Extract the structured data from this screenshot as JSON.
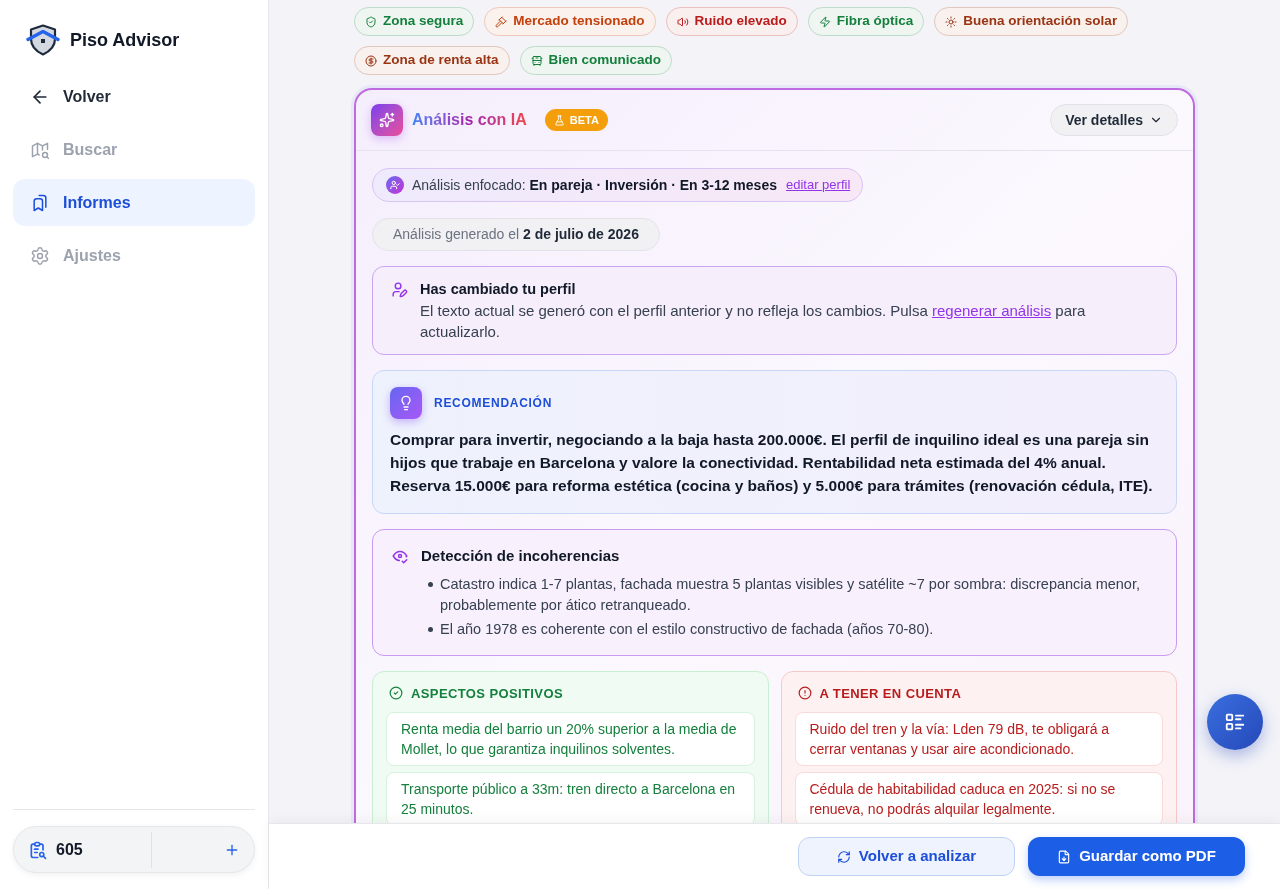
{
  "app": {
    "name": "Piso Advisor"
  },
  "sidebar": {
    "items": [
      {
        "label": "Volver",
        "kind": "back",
        "selected": false
      },
      {
        "label": "Buscar",
        "kind": "nav",
        "selected": false
      },
      {
        "label": "Informes",
        "kind": "nav",
        "selected": true
      },
      {
        "label": "Ajustes",
        "kind": "nav",
        "selected": false
      }
    ]
  },
  "credits": {
    "count": "605"
  },
  "tags": [
    {
      "label": "Zona segura",
      "color": "#15803d"
    },
    {
      "label": "Mercado tensionado",
      "color": "#c2410c"
    },
    {
      "label": "Ruido elevado",
      "color": "#b91c1c"
    },
    {
      "label": "Fibra óptica",
      "color": "#15803d"
    },
    {
      "label": "Buena orientación solar",
      "color": "#9a3412"
    },
    {
      "label": "Zona de renta alta",
      "color": "#9a3412"
    },
    {
      "label": "Bien comunicado",
      "color": "#15803d"
    }
  ],
  "analysis": {
    "title": "Análisis con IA",
    "badge": "BETA",
    "details_button": {
      "label": "Ver detalles",
      "expanded": false
    },
    "focus": {
      "text": "Análisis enfocado: **En pareja · Inversión · En 3-12 meses**",
      "link": "editar perfil"
    },
    "generated": "Análisis generado el **2 de julio de 2026**",
    "profile_notice": {
      "title": "Has cambiado tu perfil",
      "text": "El texto actual se generó con el perfil anterior y no refleja los cambios. Pulsa",
      "link": "regenerar análisis",
      "text_end": "para actualizarlo."
    },
    "recommendation": {
      "label": "RECOMENDACIÓN",
      "text": "Comprar para invertir, negociando a la baja hasta 200.000€. El perfil de inquilino ideal es una pareja sin hijos que trabaje en Barcelona y valore la conectividad. Rentabilidad neta estimada del 4% anual. Reserva 15.000€ para reforma estética (cocina y baños) y 5.000€ para trámites (renovación cédula, ITE)."
    },
    "inconsistencies": {
      "title": "Detección de incoherencias",
      "items": [
        "Catastro indica 1-7 plantas, fachada muestra 5 plantas visibles y satélite ~7 por sombra: discrepancia menor, probablemente por ático retranqueado.",
        "El año 1978 es coherente con el estilo constructivo de fachada (años 70-80)."
      ]
    },
    "positives": {
      "title": "ASPECTOS POSITIVOS",
      "items": [
        "Renta media del barrio un 20% superior a la media de Mollet, lo que garantiza inquilinos solventes.",
        "Transporte público a 33m: tren directo a Barcelona en 25 minutos."
      ]
    },
    "cautions": {
      "title": "A TENER EN CUENTA",
      "items": [
        "Ruido del tren y la vía: Lden 79 dB, te obligará a cerrar ventanas y usar aire acondicionado.",
        "Cédula de habitabilidad caduca en 2025: si no se renueva, no podrás alquilar legalmente."
      ]
    }
  },
  "footer": {
    "buttons": [
      {
        "label": "Volver a analizar",
        "kind": "secondary"
      },
      {
        "label": "Guardar como PDF",
        "kind": "primary"
      }
    ]
  }
}
